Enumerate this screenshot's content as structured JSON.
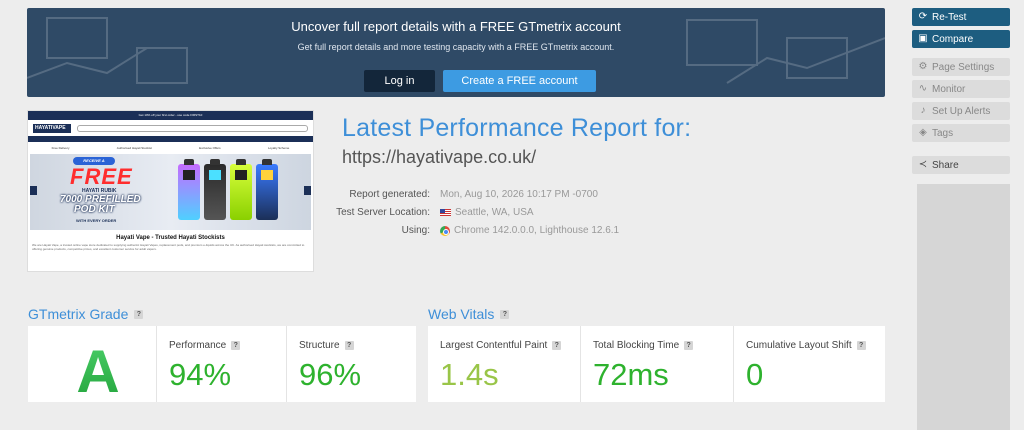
{
  "banner": {
    "title": "Uncover full report details with a FREE GTmetrix account",
    "subtitle": "Get full report details and more testing capacity with a FREE GTmetrix account.",
    "login_label": "Log in",
    "create_label": "Create a FREE account"
  },
  "sidebar": {
    "retest": "Re-Test",
    "compare": "Compare",
    "page_settings": "Page Settings",
    "monitor": "Monitor",
    "alerts": "Set Up Alerts",
    "tags": "Tags",
    "share": "Share"
  },
  "thumbnail": {
    "topbar": "Get 10% off your first order - use code FIRST10",
    "logo": "HAYATIVAPE",
    "perks": [
      "Free Delivery",
      "Authorised Hayati Stockist",
      "Exclusive Offers",
      "Loyalty Scheme"
    ],
    "pill": "RECEIVE A",
    "free": "FREE",
    "brand": "HAYATI RUBIK",
    "kit_line1": "7000 PREFILLED",
    "kit_line2": "POD KIT",
    "every": "WITH EVERY ORDER",
    "heading": "Hayati Vape - Trusted Hayati Stockists",
    "body": "We are Hayati Vape, a trusted online vape store dedicated to supplying authentic Hayati Vapes, replacement pods, and premium e-liquids across the UK. As authorised Hayati stockists, we are committed to offering genuine products, competitive prices, and excellent customer service for adult vapers."
  },
  "report": {
    "title": "Latest Performance Report for:",
    "url": "https://hayativape.co.uk/",
    "generated_label": "Report generated:",
    "generated_value": "Mon, Aug 10, 2026 10:17 PM -0700",
    "location_label": "Test Server Location:",
    "location_value": "Seattle, WA, USA",
    "using_label": "Using:",
    "using_value": "Chrome 142.0.0.0, Lighthouse 12.6.1"
  },
  "grade": {
    "section_title": "GTmetrix Grade",
    "letter": "A",
    "performance_label": "Performance",
    "performance_value": "94%",
    "structure_label": "Structure",
    "structure_value": "96%"
  },
  "vitals": {
    "section_title": "Web Vitals",
    "lcp_label": "Largest Contentful Paint",
    "lcp_value": "1.4s",
    "tbt_label": "Total Blocking Time",
    "tbt_value": "72ms",
    "cls_label": "Cumulative Layout Shift",
    "cls_value": "0"
  },
  "help_glyph": "?",
  "colors": {
    "accent": "#3e8fd8",
    "good": "#2eb22e",
    "ok": "#99c548",
    "primary": "#1d5d80"
  }
}
